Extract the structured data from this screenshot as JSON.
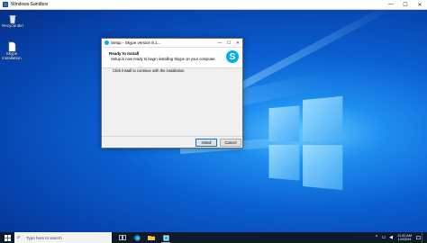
{
  "window": {
    "title": "Windows Sandbox",
    "minimize_glyph": "—",
    "maximize_glyph": "☐",
    "close_glyph": "✕"
  },
  "desktop": {
    "icons": [
      {
        "label": "Recycle Bin",
        "icon": "recycle-bin-icon"
      },
      {
        "label": "Skype installation",
        "icon": "file-icon"
      }
    ]
  },
  "dialog": {
    "title": "Setup - Skype version 8.1...",
    "header_title": "Ready to Install",
    "header_subtitle": "Setup is now ready to begin installing Skype on your computer.",
    "skype_glyph": "S",
    "body_text": "Click Install to continue with the installation.",
    "install_label": "Install",
    "cancel_label": "Cancel",
    "minimize_glyph": "—",
    "maximize_glyph": "☐",
    "close_glyph": "✕"
  },
  "taskbar": {
    "search_placeholder": "Type here to search",
    "search_glyph": "⌕",
    "apps": [
      "task-view-icon",
      "edge-icon",
      "file-explorer-icon",
      "setup-icon"
    ],
    "tray": {
      "chevron": "^",
      "network": "▭",
      "volume": "◀",
      "time": "11:32 AM",
      "date": "1/4/2024"
    }
  },
  "colors": {
    "accent": "#0078d7",
    "skype": "#00aff0",
    "taskbar": "#0e1a2b"
  }
}
